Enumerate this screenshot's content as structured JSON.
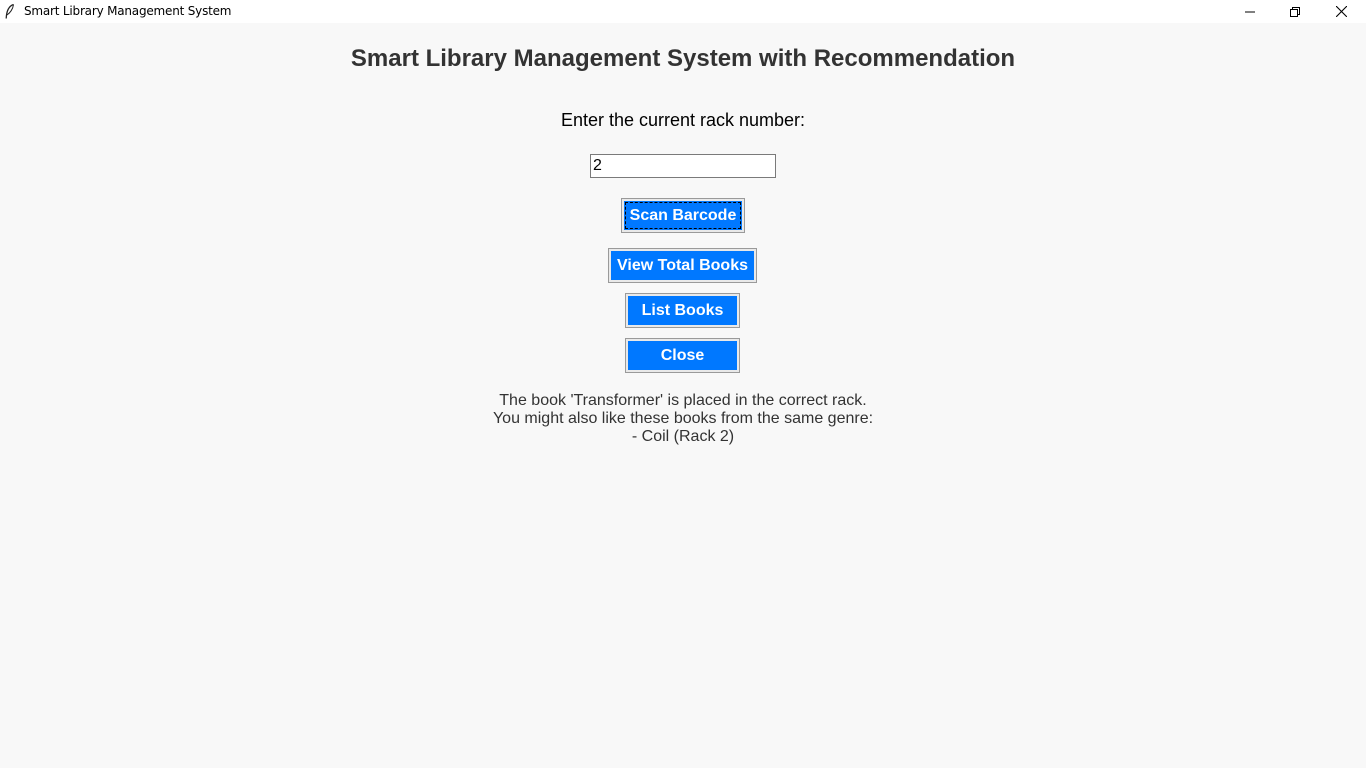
{
  "window": {
    "title": "Smart Library Management System",
    "icon": "feather-icon",
    "controls": {
      "minimize_icon": "minimize-icon",
      "maximize_icon": "restore-icon",
      "close_icon": "close-icon"
    }
  },
  "main": {
    "heading": "Smart Library Management System with Recommendation",
    "rack_label": "Enter the current rack number:",
    "rack_value": "2",
    "buttons": {
      "scan": "Scan Barcode",
      "view_total": "View Total Books",
      "list": "List Books",
      "close": "Close"
    },
    "result_lines": [
      "The book 'Transformer' is placed in the correct rack.",
      "You might also like these books from the same genre:",
      "- Coil (Rack 2)"
    ]
  },
  "colors": {
    "button_bg": "#0078ff",
    "button_text": "#ffffff",
    "heading_text": "#333333",
    "background": "#f8f8f8"
  }
}
